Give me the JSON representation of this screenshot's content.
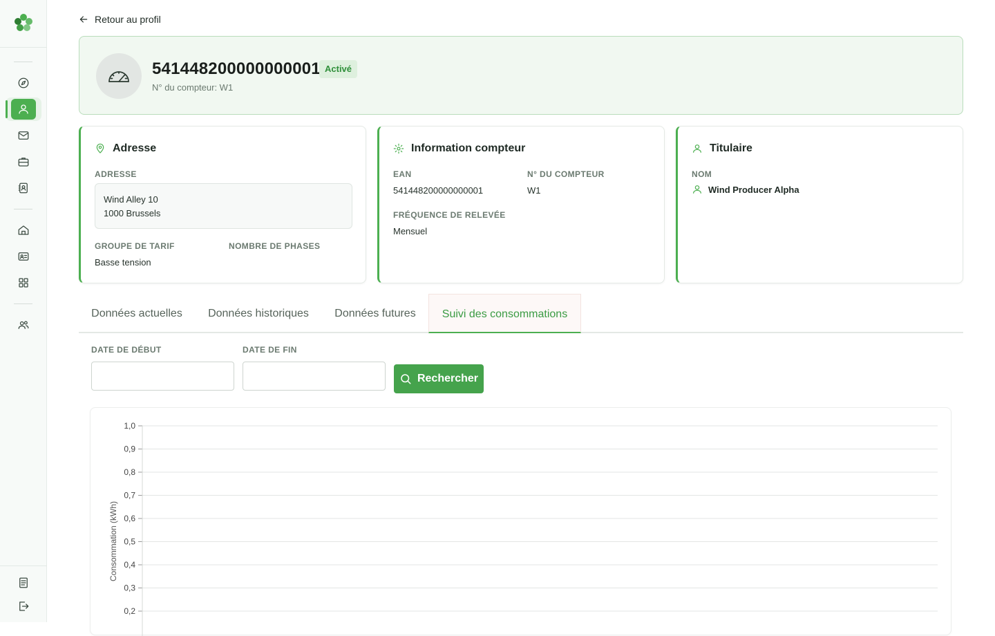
{
  "app": {
    "back_label": "Retour au profil"
  },
  "header": {
    "ean": "541448200000000001",
    "status": "Activé",
    "subtitle": "N° du compteur: W1"
  },
  "address_card": {
    "title": "Adresse",
    "address_label": "ADRESSE",
    "address_line1": "Wind Alley 10",
    "address_line2": "1000 Brussels",
    "tariff_label": "GROUPE DE TARIF",
    "tariff_value": "Basse tension",
    "phases_label": "NOMBRE DE PHASES",
    "phases_value": ""
  },
  "meter_card": {
    "title": "Information compteur",
    "ean_label": "EAN",
    "ean_value": "541448200000000001",
    "meter_no_label": "N° DU COMPTEUR",
    "meter_no_value": "W1",
    "frequency_label": "FRÉQUENCE DE RELEVÉE",
    "frequency_value": "Mensuel"
  },
  "owner_card": {
    "title": "Titulaire",
    "name_label": "NOM",
    "name_value": "Wind Producer Alpha"
  },
  "tabs": [
    {
      "label": "Données actuelles",
      "active": false
    },
    {
      "label": "Données historiques",
      "active": false
    },
    {
      "label": "Données futures",
      "active": false
    },
    {
      "label": "Suivi des consommations",
      "active": true
    }
  ],
  "filters": {
    "start_label": "DATE DE DÉBUT",
    "end_label": "DATE DE FIN",
    "start_value": "",
    "end_value": "",
    "search_label": "Rechercher"
  },
  "colors": {
    "accent": "#4caf50",
    "badge_bg": "#def0de",
    "badge_text": "#2f8f3a"
  },
  "sidebar": {
    "items": [
      {
        "icon": "compass-icon",
        "active": false
      },
      {
        "icon": "user-icon",
        "active": true
      },
      {
        "icon": "mail-icon",
        "active": false
      },
      {
        "icon": "briefcase-icon",
        "active": false
      },
      {
        "icon": "contact-book-icon",
        "active": false
      },
      {
        "icon": "home-icon",
        "active": false
      },
      {
        "icon": "id-card-icon",
        "active": false
      },
      {
        "icon": "grid-icon",
        "active": false
      },
      {
        "icon": "users-icon",
        "active": false
      },
      {
        "icon": "document-icon",
        "active": false
      },
      {
        "icon": "logout-icon",
        "active": false
      }
    ]
  },
  "chart_data": {
    "type": "line",
    "title": "",
    "xlabel": "",
    "ylabel": "Consommation (kWh)",
    "ylim": [
      0.2,
      1.0
    ],
    "y_ticks": [
      "0,2",
      "0,3",
      "0,4",
      "0,5",
      "0,6",
      "0,7",
      "0,8",
      "0,9",
      "1,0"
    ],
    "grid": true,
    "series": []
  }
}
